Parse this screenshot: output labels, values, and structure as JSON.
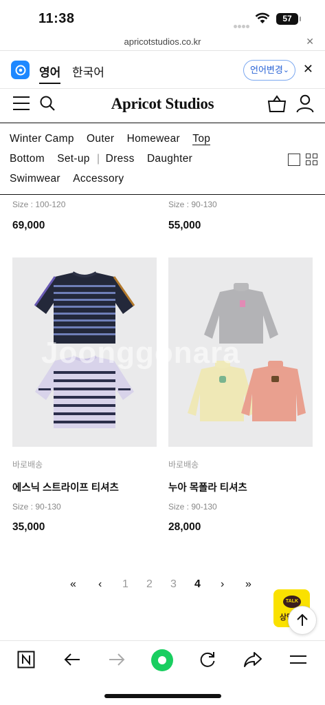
{
  "status": {
    "time": "11:38",
    "battery": "57"
  },
  "urlbar": {
    "url": "apricotstudios.co.kr"
  },
  "translate": {
    "lang_en": "영어",
    "lang_ko": "한국어",
    "change_label": "언어변경"
  },
  "site": {
    "logo": "Apricot Studios"
  },
  "categories": {
    "row1": [
      "Winter Camp",
      "Outer",
      "Homewear",
      "Top"
    ],
    "row2": [
      "Bottom",
      "Set-up",
      "|",
      "Dress",
      "Daughter"
    ],
    "row3": [
      "Swimwear",
      "Accessory"
    ],
    "active": "Top"
  },
  "previous_items": [
    {
      "size": "Size : 100-120",
      "price": "69,000"
    },
    {
      "size": "Size : 90-130",
      "price": "55,000"
    }
  ],
  "products": [
    {
      "tag": "바로배송",
      "name": "에스닉 스트라이프 티셔츠",
      "size": "Size : 90-130",
      "price": "35,000"
    },
    {
      "tag": "바로배송",
      "name": "누아 목폴라 티셔츠",
      "size": "Size : 90-130",
      "price": "28,000"
    }
  ],
  "watermark": "Joonggonara",
  "pagination": {
    "first": "«",
    "prev": "‹",
    "pages": [
      "1",
      "2",
      "3",
      "4"
    ],
    "current": "4",
    "next": "›",
    "last": "»"
  },
  "floaters": {
    "talk_bubble": "TALK",
    "talk_label": "상담"
  },
  "colors": {
    "translate_accent": "#2a64d6",
    "talk_yellow": "#fae100",
    "toolbar_green": "#19ce60"
  }
}
